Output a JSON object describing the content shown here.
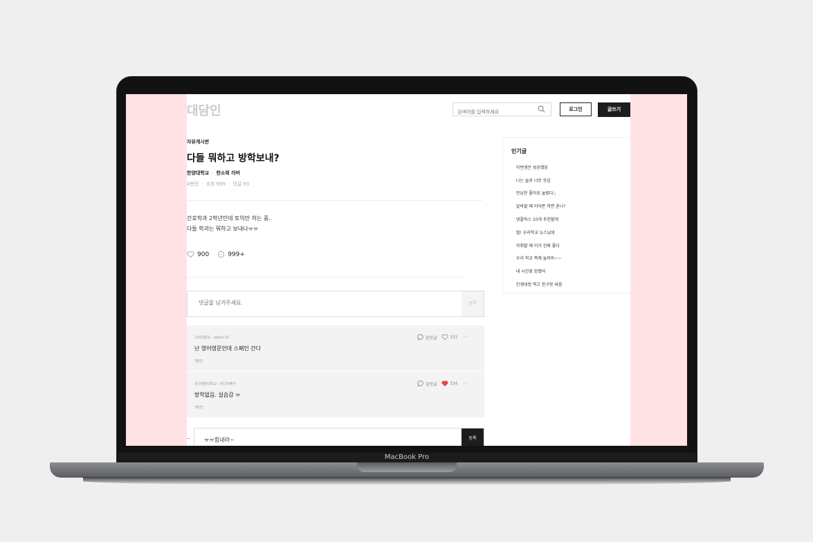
{
  "device": {
    "label": "MacBook Pro"
  },
  "header": {
    "logo": "대담인",
    "search_placeholder": "검색어를 입력하세요",
    "login_label": "로그인",
    "write_label": "글쓰기"
  },
  "post": {
    "category": "자유게시판",
    "title": "다들 뭐하고 방학보내?",
    "school": "한양대학교",
    "author": "한소희 러버",
    "time": "4분전",
    "views": "조회 999",
    "comments_count": "댓글 93",
    "body_line1": "간호학과 2학년인데 토익만 하는 중..",
    "body_line2": "다들 학과는 뭐하고 보내나ㅠㅠ",
    "likes": "900",
    "comments": "999+"
  },
  "comment_form": {
    "placeholder": "댓글을 남겨주세요.",
    "submit_label": "등록"
  },
  "comments": [
    {
      "author": "고려대학교 · qwer123",
      "text": "난 영어영문인데 스페인 간다",
      "time": "3분전",
      "reply_label": "답맛글",
      "likes": "333",
      "liked": false
    },
    {
      "author": "한국해양대학교 · 바다아빠가",
      "text": "방학없음. 실습감 ㅠ",
      "time": "3분전",
      "reply_label": "답맛글",
      "likes": "334",
      "liked": true
    }
  ],
  "reply_form": {
    "value": "ㅠㅠ힘내라~",
    "submit_label": "등록"
  },
  "sidebar": {
    "title": "인기글",
    "items": [
      "이번생은 성공했당",
      "나는 솔로 너무 웃김",
      "전남친 좋아요 눌렀다;;",
      "알바할 때 이어폰 끼면 혼나?",
      "넷플릭스 10개 추천할게",
      "헐! 우리학교 뉴스났네",
      "자취할 때 이거 진짜 좋다",
      "우리 학교 축제 놀러와~~",
      "내 시간표 망했어",
      "인생네컷 찍고 친구랑 싸움"
    ]
  },
  "colors": {
    "screen_background": "#ffe3e4",
    "heart_active": "#e8434d",
    "button_dark": "#1d1d1d"
  }
}
